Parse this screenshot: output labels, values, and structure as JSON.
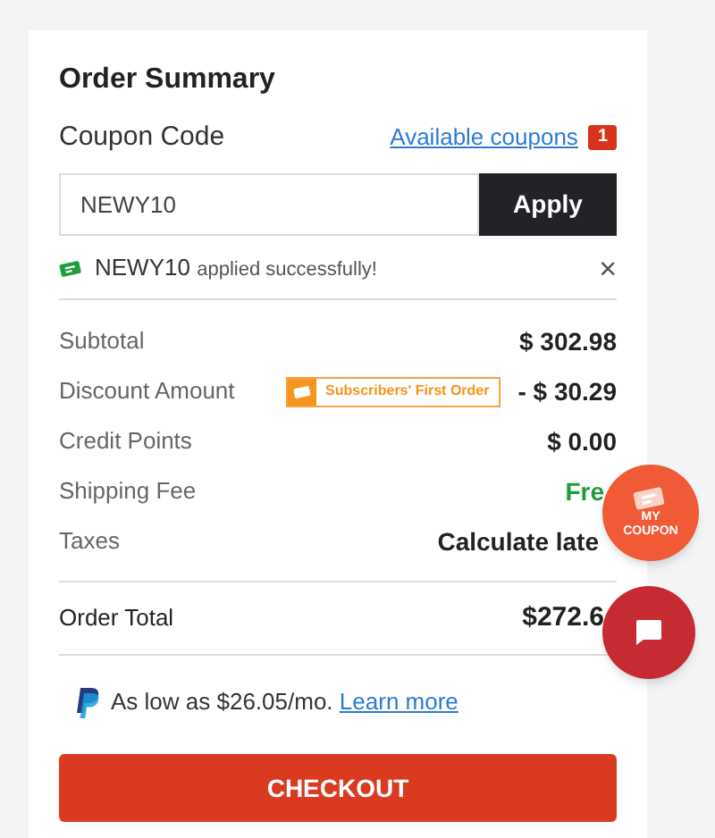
{
  "title": "Order Summary",
  "coupon": {
    "label": "Coupon Code",
    "link": "Available coupons",
    "count": "1",
    "value": "NEWY10",
    "apply": "Apply",
    "success_code": "NEWY10",
    "success_text": "applied successfully!",
    "close": "×"
  },
  "rows": [
    {
      "label": "Subtotal",
      "value": "$ 302.98",
      "kind": "plain"
    },
    {
      "label": "Discount Amount",
      "value": "- $ 30.29",
      "kind": "tagged",
      "tag": "Subscribers' First Order"
    },
    {
      "label": "Credit Points",
      "value": "$ 0.00",
      "kind": "plain"
    },
    {
      "label": "Shipping Fee",
      "value": "Fre",
      "kind": "free"
    },
    {
      "label": "Taxes",
      "value": "Calculate late",
      "kind": "plain"
    }
  ],
  "total": {
    "label": "Order Total",
    "value": "$272.6"
  },
  "paypal": {
    "text": "As low as $26.05/mo.",
    "link": "Learn more"
  },
  "checkout": "CHECKOUT",
  "floating": {
    "coupon_label": "MY COUPON"
  }
}
